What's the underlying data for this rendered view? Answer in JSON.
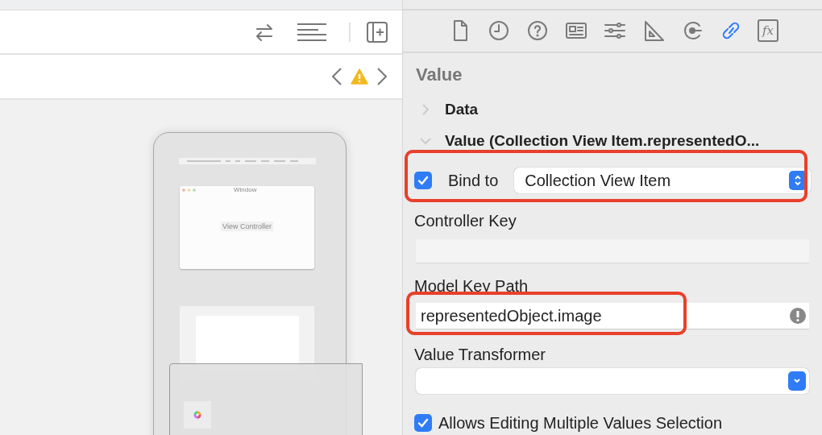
{
  "inspector_tabs": [
    {
      "kind": "file",
      "selected": false
    },
    {
      "kind": "history",
      "selected": false
    },
    {
      "kind": "help",
      "selected": false
    },
    {
      "kind": "identity",
      "selected": false
    },
    {
      "kind": "attributes",
      "selected": false
    },
    {
      "kind": "size",
      "selected": false
    },
    {
      "kind": "connections",
      "selected": false
    },
    {
      "kind": "bindings",
      "selected": true
    },
    {
      "kind": "effects",
      "label": "fx",
      "selected": false
    }
  ],
  "canvas": {
    "window_title": "Window",
    "view_controller": "View Controller"
  },
  "section_title": "Value",
  "groups": [
    {
      "title": "Data",
      "expanded": false
    },
    {
      "title": "Value (Collection View Item.representedO...",
      "expanded": true
    }
  ],
  "bind": {
    "checked": true,
    "label": "Bind to",
    "value": "Collection View Item"
  },
  "controller_key": {
    "label": "Controller Key"
  },
  "model_key_path": {
    "label": "Model Key Path",
    "value": "representedObject.image",
    "warning": true
  },
  "value_transformer": {
    "label": "Value Transformer"
  },
  "allows_editing": {
    "checked": true,
    "label": "Allows Editing Multiple Values Selection"
  }
}
